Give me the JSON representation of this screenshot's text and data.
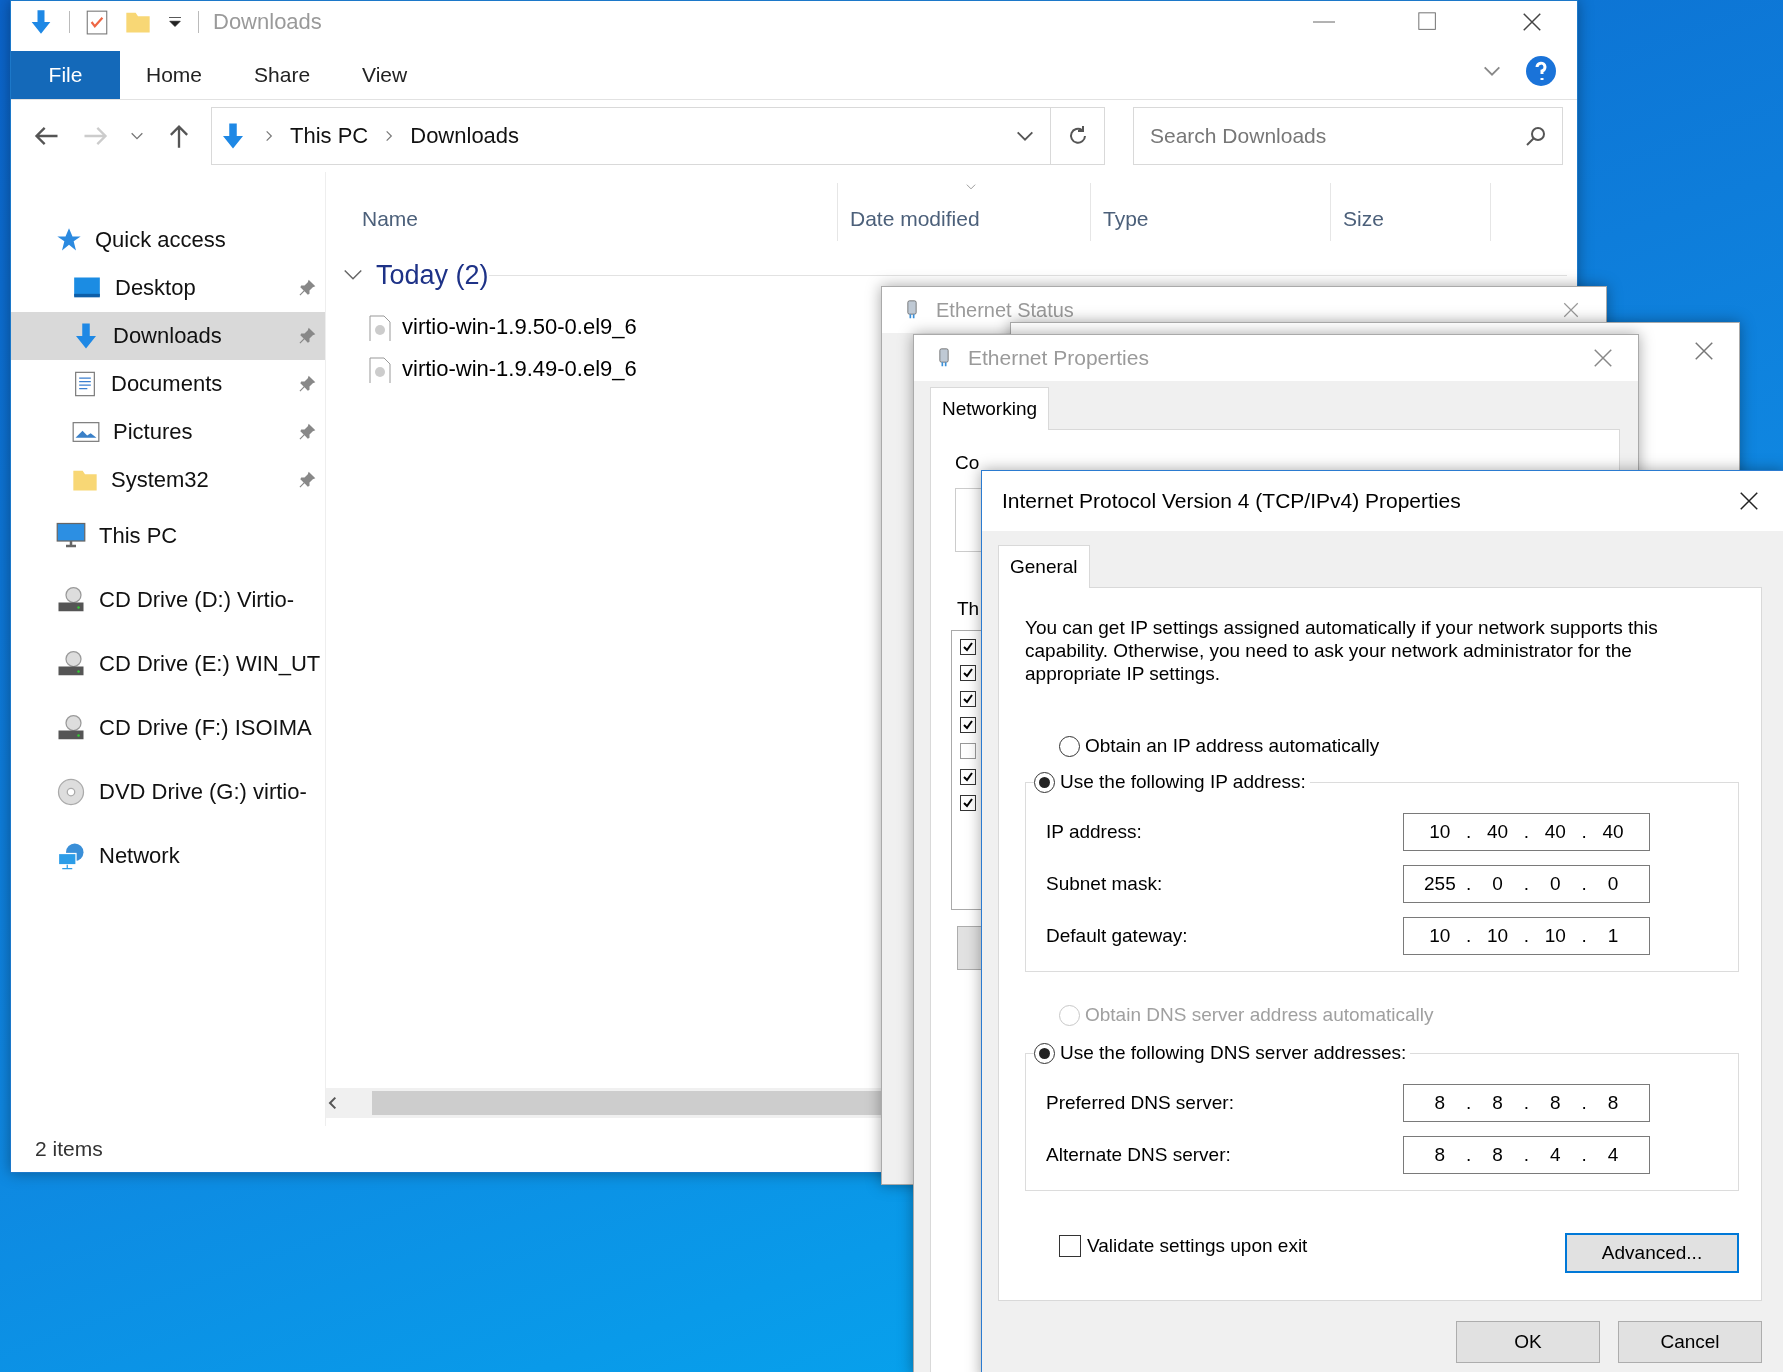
{
  "explorer": {
    "title": "Downloads",
    "ribbon_tabs": [
      {
        "label": "File",
        "kind": "menu"
      },
      {
        "label": "Home",
        "kind": "tab"
      },
      {
        "label": "Share",
        "kind": "tab"
      },
      {
        "label": "View",
        "kind": "tab"
      }
    ],
    "address": [
      "This PC",
      "Downloads"
    ],
    "search": {
      "placeholder": "Search Downloads"
    },
    "sidebar": {
      "items": [
        {
          "label": "Quick access",
          "kind": "star",
          "selected": false,
          "children": [
            {
              "label": "Desktop",
              "kind": "desktop",
              "selected": false,
              "pinned": true
            },
            {
              "label": "Downloads",
              "kind": "download",
              "selected": true,
              "pinned": true
            },
            {
              "label": "Documents",
              "kind": "documents",
              "selected": false,
              "pinned": true
            },
            {
              "label": "Pictures",
              "kind": "pictures",
              "selected": false,
              "pinned": true
            },
            {
              "label": "System32",
              "kind": "folder",
              "selected": false,
              "pinned": true
            }
          ]
        },
        {
          "label": "This PC",
          "kind": "pc",
          "selected": false
        },
        {
          "label": "CD Drive (D:) Virtio-",
          "kind": "cd",
          "selected": false
        },
        {
          "label": "CD Drive (E:) WIN_UT",
          "kind": "cd",
          "selected": false
        },
        {
          "label": "CD Drive (F:) ISOIMA",
          "kind": "cd",
          "selected": false
        },
        {
          "label": "DVD Drive (G:) virtio-",
          "kind": "dvd",
          "selected": false
        },
        {
          "label": "Network",
          "kind": "network",
          "selected": false
        }
      ]
    },
    "columns": [
      {
        "label": "Name",
        "sorted": false
      },
      {
        "label": "Date modified",
        "sorted": true
      },
      {
        "label": "Type",
        "sorted": false
      },
      {
        "label": "Size",
        "sorted": false
      }
    ],
    "groups": [
      {
        "label": "Today (2)",
        "expanded": true,
        "files": [
          "virtio-win-1.9.50-0.el9_6",
          "virtio-win-1.9.49-0.el9_6"
        ]
      }
    ],
    "status_bar": "2 items"
  },
  "ethernet_status": {
    "title": "Ethernet Status"
  },
  "ethernet_properties": {
    "title": "Ethernet Properties",
    "tabs": [
      {
        "label": "Networking",
        "selected": true
      }
    ],
    "connect_label": "Co",
    "items_label": "Th",
    "components": [
      {
        "checked": true
      },
      {
        "checked": true
      },
      {
        "checked": true
      },
      {
        "checked": true
      },
      {
        "checked": false
      },
      {
        "checked": true
      },
      {
        "checked": true
      }
    ]
  },
  "ipv4_properties": {
    "title": "Internet Protocol Version 4 (TCP/IPv4) Properties",
    "tabs": [
      {
        "label": "General",
        "selected": true
      }
    ],
    "description": "You can get IP settings assigned automatically if your network supports this capability. Otherwise, you need to ask your network administrator for the appropriate IP settings.",
    "ip_auto": {
      "label": "Obtain an IP address automatically",
      "selected": false,
      "disabled": false
    },
    "ip_manual": {
      "label": "Use the following IP address:",
      "selected": true,
      "disabled": false
    },
    "ip_fields": [
      {
        "label": "IP address:",
        "octets": [
          "10",
          ".",
          "40",
          ".",
          "40",
          ".",
          "40"
        ]
      },
      {
        "label": "Subnet mask:",
        "octets": [
          "255",
          ".",
          "0",
          ".",
          "0",
          ".",
          "0"
        ]
      },
      {
        "label": "Default gateway:",
        "octets": [
          "10",
          ".",
          "10",
          ".",
          "10",
          ".",
          "1"
        ]
      }
    ],
    "dns_auto": {
      "label": "Obtain DNS server address automatically",
      "selected": false,
      "disabled": true
    },
    "dns_manual": {
      "label": "Use the following DNS server addresses:",
      "selected": true,
      "disabled": false
    },
    "dns_fields": [
      {
        "label": "Preferred DNS server:",
        "octets": [
          "8",
          ".",
          "8",
          ".",
          "8",
          ".",
          "8"
        ]
      },
      {
        "label": "Alternate DNS server:",
        "octets": [
          "8",
          ".",
          "8",
          ".",
          "4",
          ".",
          "4"
        ]
      }
    ],
    "validate": {
      "label": "Validate settings upon exit",
      "checked": false
    },
    "advanced": {
      "label": "Advanced...",
      "focused": true
    },
    "buttons": [
      "OK",
      "Cancel"
    ]
  }
}
